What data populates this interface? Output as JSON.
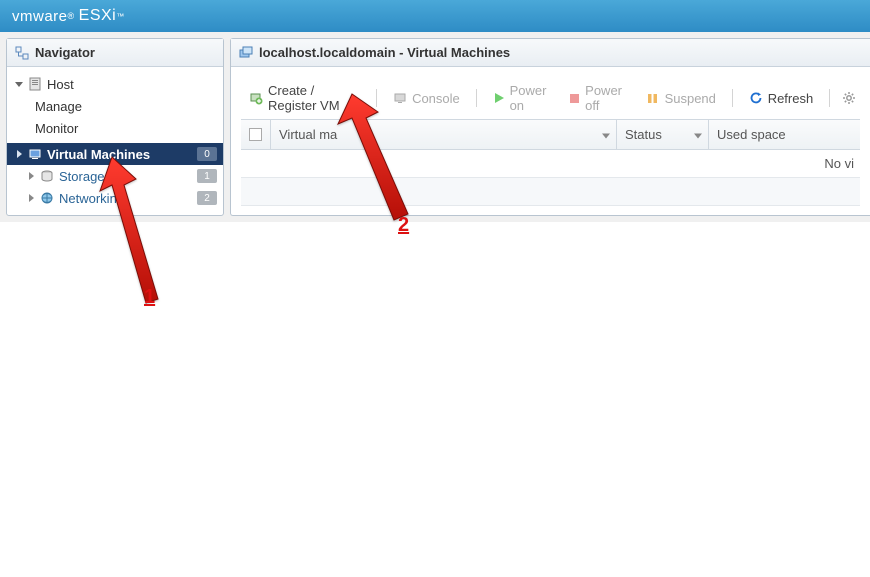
{
  "brand": {
    "vm": "vm",
    "ware": "ware",
    "esxi": "ESXi"
  },
  "navigator": {
    "title": "Navigator",
    "host": {
      "label": "Host",
      "children": {
        "manage": "Manage",
        "monitor": "Monitor"
      }
    },
    "items": [
      {
        "label": "Virtual Machines",
        "badge": "0"
      },
      {
        "label": "Storage",
        "badge": "1"
      },
      {
        "label": "Networking",
        "badge": "2"
      }
    ]
  },
  "main": {
    "title": "localhost.localdomain - Virtual Machines",
    "toolbar": {
      "create": "Create / Register VM",
      "console": "Console",
      "poweron": "Power on",
      "poweroff": "Power off",
      "suspend": "Suspend",
      "refresh": "Refresh"
    },
    "grid": {
      "cols": {
        "vm": "Virtual ma",
        "status": "Status",
        "used": "Used space"
      },
      "empty_row": "No vi"
    }
  },
  "annotations": {
    "one": "1",
    "two": "2"
  },
  "colors": {
    "accent": "#1d3b66",
    "toolbar_blue": "#1f6fd0",
    "arrow_red": "#e11"
  }
}
